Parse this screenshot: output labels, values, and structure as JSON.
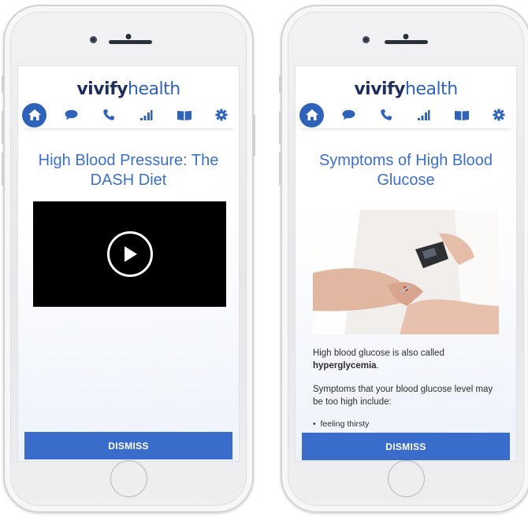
{
  "brand": {
    "logo_part1": "vivify",
    "logo_part2": "health"
  },
  "phone_left": {
    "title": "High Blood Pressure: The DASH Diet",
    "dismiss_label": "DISMISS"
  },
  "phone_right": {
    "title": "Symptoms of High Blood Glucose",
    "paragraph1_text": "High blood glucose is also called ",
    "paragraph1_bold": "hyperglycemia",
    "paragraph1_end": ".",
    "paragraph2": "Symptoms that your blood glucose level may be too high include:",
    "bullet1": "feeling thirsty",
    "dismiss_label": "DISMISS"
  },
  "nav_icons": [
    "home-icon",
    "chat-icon",
    "phone-icon",
    "bar-chart-icon",
    "book-icon",
    "gear-icon"
  ],
  "colors": {
    "accent": "#3a6ccb",
    "title": "#3c6fc8",
    "logo_dark": "#1f2f5a"
  }
}
